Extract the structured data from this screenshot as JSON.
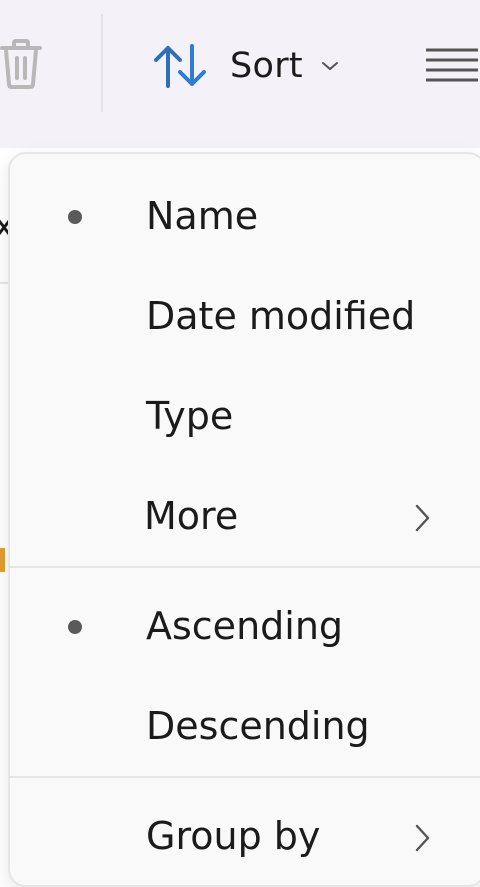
{
  "toolbar": {
    "icons": [
      "trash-icon",
      "sort-icon",
      "chevron-down-icon",
      "view-icon"
    ],
    "sort_label": "Sort",
    "accent_color": "#2f7cd3"
  },
  "sort_menu": {
    "items": [
      {
        "label": "Name",
        "selected": true
      },
      {
        "label": "Date modified",
        "selected": false
      },
      {
        "label": "Type",
        "selected": false
      },
      {
        "label": "More",
        "selected": false,
        "has_submenu": true
      }
    ],
    "order_items": [
      {
        "label": "Ascending",
        "selected": true
      },
      {
        "label": "Descending",
        "selected": false
      }
    ],
    "group_items": [
      {
        "label": "Group by",
        "has_submenu": true
      }
    ]
  }
}
